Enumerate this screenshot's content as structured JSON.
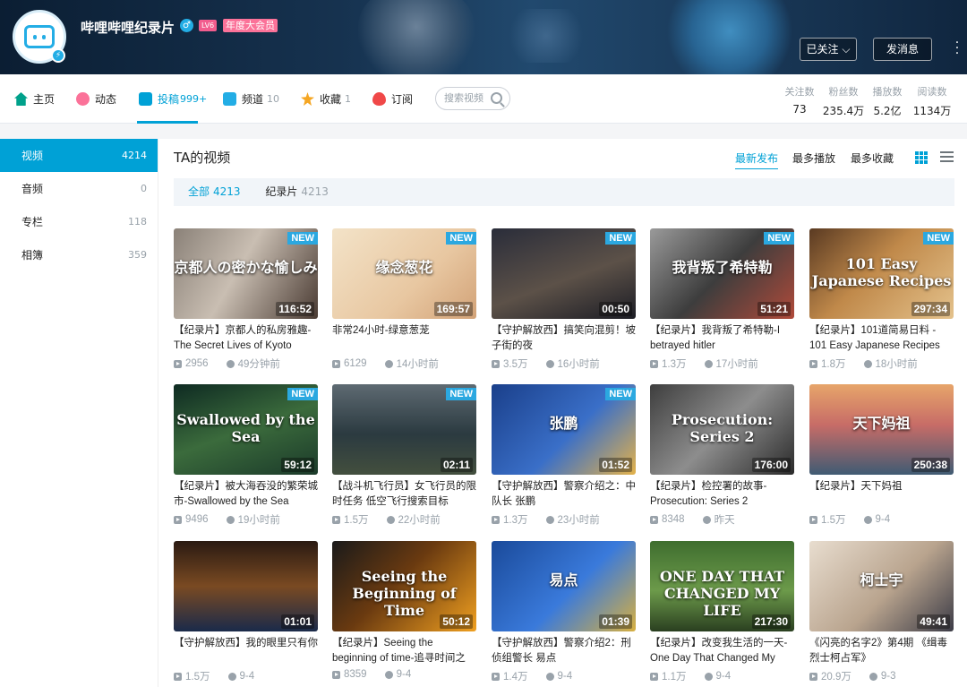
{
  "header": {
    "username": "哔哩哔哩纪录片",
    "level": "LV6",
    "vip_badge": "年度大会员",
    "follow_button": "已关注",
    "message_button": "发消息"
  },
  "nav": {
    "home": "主页",
    "dynamic": "动态",
    "uploads": "投稿",
    "uploads_count": "999+",
    "channels": "频道",
    "channels_count": "10",
    "favorites": "收藏",
    "favorites_count": "1",
    "subscriptions": "订阅",
    "search_placeholder": "搜索视频"
  },
  "stats": [
    {
      "label": "关注数",
      "value": "73"
    },
    {
      "label": "粉丝数",
      "value": "235.4万"
    },
    {
      "label": "播放数",
      "value": "5.2亿"
    },
    {
      "label": "阅读数",
      "value": "1134万"
    }
  ],
  "sidebar": {
    "items": [
      {
        "label": "视频",
        "count": "4214"
      },
      {
        "label": "音频",
        "count": "0"
      },
      {
        "label": "专栏",
        "count": "118"
      },
      {
        "label": "相簿",
        "count": "359"
      }
    ]
  },
  "main": {
    "title": "TA的视频",
    "sort": [
      "最新发布",
      "最多播放",
      "最多收藏"
    ],
    "filters": [
      {
        "label": "全部",
        "count": "4213"
      },
      {
        "label": "纪录片",
        "count": "4213"
      }
    ]
  },
  "videos": [
    {
      "thumb_text": "京都人の密かな愉しみ",
      "new": "NEW",
      "duration": "116:52",
      "title": "【纪录片】京都人的私房雅趣-The Secret Lives of Kyoto",
      "plays": "2956",
      "time": "49分钟前"
    },
    {
      "thumb_text": "缘念葱花",
      "new": "NEW",
      "duration": "169:57",
      "title": "非常24小时-绿意葱茏",
      "plays": "6129",
      "time": "14小时前"
    },
    {
      "thumb_text": "",
      "new": "NEW",
      "duration": "00:50",
      "title": "【守护解放西】搞笑向混剪！坡子街的夜",
      "plays": "3.5万",
      "time": "16小时前"
    },
    {
      "thumb_text": "我背叛了希特勒",
      "new": "NEW",
      "duration": "51:21",
      "title": "【纪录片】我背叛了希特勒-I betrayed hitler",
      "plays": "1.3万",
      "time": "17小时前"
    },
    {
      "thumb_text": "101 Easy Japanese Recipes",
      "new": "NEW",
      "duration": "297:34",
      "title": "【纪录片】101道简易日料 - 101 Easy Japanese Recipes",
      "plays": "1.8万",
      "time": "18小时前"
    },
    {
      "thumb_text": "Swallowed by the Sea",
      "new": "NEW",
      "duration": "59:12",
      "title": "【纪录片】被大海吞没的繁荣城市-Swallowed by the Sea",
      "plays": "9496",
      "time": "19小时前"
    },
    {
      "thumb_text": "",
      "new": "NEW",
      "duration": "02:11",
      "title": "【战斗机飞行员】女飞行员的限时任务 低空飞行搜索目标",
      "plays": "1.5万",
      "time": "22小时前"
    },
    {
      "thumb_text": "张鹏",
      "new": "NEW",
      "duration": "01:52",
      "title": "【守护解放西】警察介绍之：中队长 张鹏",
      "plays": "1.3万",
      "time": "23小时前"
    },
    {
      "thumb_text": "Prosecution: Series 2",
      "new": "",
      "duration": "176:00",
      "title": "【纪录片】检控署的故事-Prosecution: Series 2",
      "plays": "8348",
      "time": "昨天"
    },
    {
      "thumb_text": "天下妈祖",
      "new": "",
      "duration": "250:38",
      "title": "【纪录片】天下妈祖",
      "plays": "1.5万",
      "time": "9-4"
    },
    {
      "thumb_text": "",
      "new": "",
      "duration": "01:01",
      "title": "【守护解放西】我的眼里只有你",
      "plays": "1.5万",
      "time": "9-4"
    },
    {
      "thumb_text": "Seeing the Beginning of Time",
      "new": "",
      "duration": "50:12",
      "title": "【纪录片】Seeing the beginning of time-追寻时间之",
      "plays": "8359",
      "time": "9-4"
    },
    {
      "thumb_text": "易点",
      "new": "",
      "duration": "01:39",
      "title": "【守护解放西】警察介绍2：刑侦组警长 易点",
      "plays": "1.4万",
      "time": "9-4"
    },
    {
      "thumb_text": "ONE DAY THAT CHANGED MY LIFE",
      "new": "",
      "duration": "217:30",
      "title": "【纪录片】改变我生活的一天-One Day That Changed My",
      "plays": "1.1万",
      "time": "9-4"
    },
    {
      "thumb_text": "柯士宇",
      "new": "",
      "duration": "49:41",
      "title": "《闪亮的名字2》第4期 《缉毒烈士柯占军》",
      "plays": "20.9万",
      "time": "9-3"
    }
  ],
  "colors": {
    "accent": "#00a1d6",
    "pink": "#fb7299"
  }
}
